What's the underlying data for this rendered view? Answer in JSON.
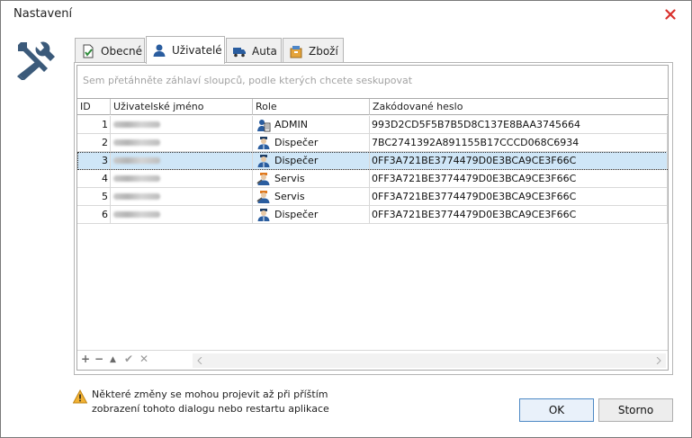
{
  "window": {
    "title": "Nastavení",
    "close_icon": "close-icon"
  },
  "tabs": [
    {
      "label": "Obecné",
      "icon": "document-check-icon",
      "active": false
    },
    {
      "label": "Uživatelé",
      "icon": "user-icon",
      "active": true
    },
    {
      "label": "Auta",
      "icon": "truck-icon",
      "active": false
    },
    {
      "label": "Zboží",
      "icon": "box-icon",
      "active": false
    }
  ],
  "grid": {
    "group_hint": "Sem přetáhněte záhlaví sloupců, podle kterých chcete seskupovat",
    "columns": [
      "ID",
      "Uživatelské jméno",
      "Role",
      "Zakódované heslo"
    ],
    "rows": [
      {
        "id": "1",
        "role": "ADMIN",
        "role_icon": "admin-icon",
        "hash": "993D2CD5F5B7B5D8C137E8BAA3745664"
      },
      {
        "id": "2",
        "role": "Dispečer",
        "role_icon": "dispatcher-icon",
        "hash": "7BC2741392A891155B17CCCD068C6934"
      },
      {
        "id": "3",
        "role": "Dispečer",
        "role_icon": "dispatcher-icon",
        "hash": "0FF3A721BE3774479D0E3BCA9CE3F66C",
        "selected": true
      },
      {
        "id": "4",
        "role": "Servis",
        "role_icon": "service-icon",
        "hash": "0FF3A721BE3774479D0E3BCA9CE3F66C"
      },
      {
        "id": "5",
        "role": "Servis",
        "role_icon": "service-icon",
        "hash": "0FF3A721BE3774479D0E3BCA9CE3F66C"
      },
      {
        "id": "6",
        "role": "Dispečer",
        "role_icon": "dispatcher-icon",
        "hash": "0FF3A721BE3774479D0E3BCA9CE3F66C"
      }
    ],
    "navigator": {
      "add": "+",
      "remove": "−",
      "up": "▲",
      "confirm": "✔",
      "cancel": "✕"
    }
  },
  "warning": {
    "line1": "Některé změny se mohou projevit až při příštím",
    "line2": "zobrazení tohoto dialogu nebo restartu aplikace"
  },
  "buttons": {
    "ok": "OK",
    "cancel": "Storno"
  },
  "colors": {
    "selection": "#cfe6f7",
    "close_x": "#d9302c",
    "ok_border": "#4c88c4"
  }
}
